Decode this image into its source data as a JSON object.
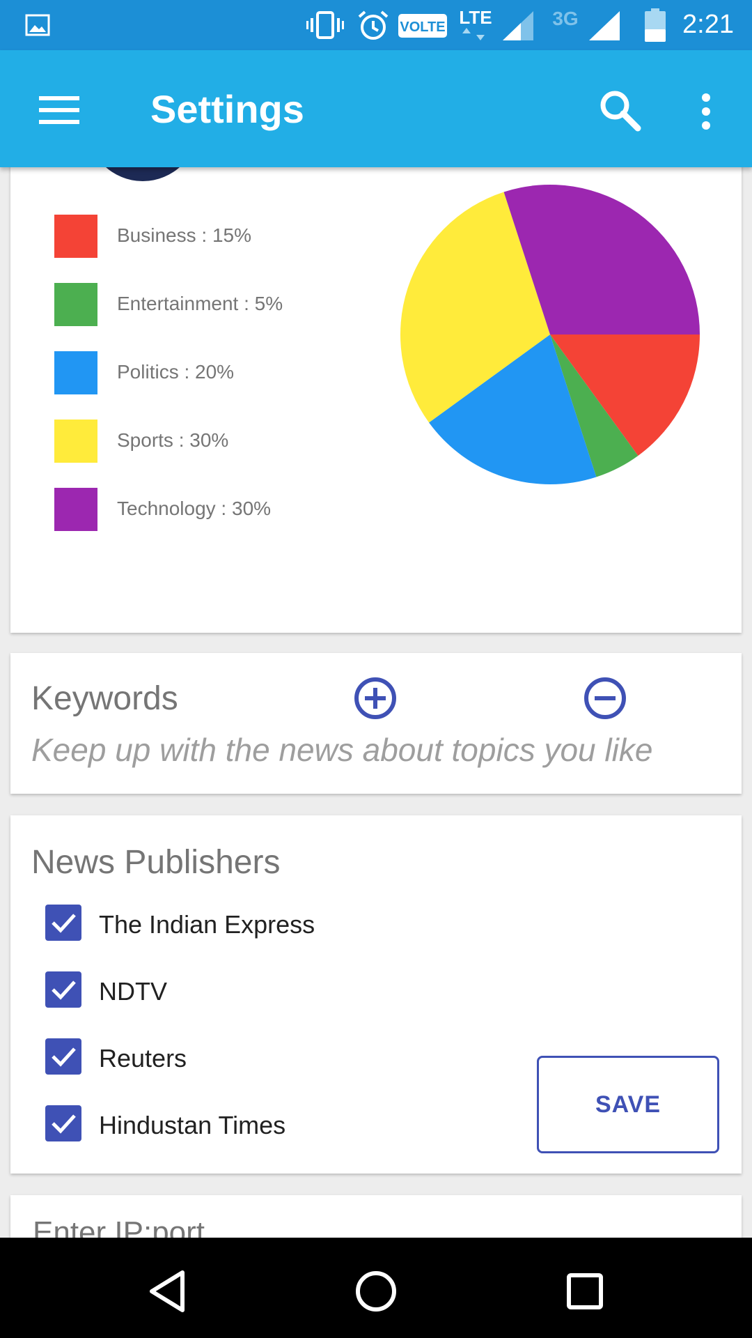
{
  "status_bar": {
    "time": "2:21",
    "volte_label": "VOLTE",
    "lte_label": "LTE",
    "network_label": "3G",
    "icons": [
      "image-icon",
      "vibrate-icon",
      "alarm-icon",
      "volte-icon",
      "lte-icon",
      "signal-icon",
      "signal-3g-icon",
      "battery-icon"
    ]
  },
  "app_bar": {
    "title": "Settings",
    "icons": [
      "menu-icon",
      "search-icon",
      "more-vert-icon"
    ]
  },
  "chart_data": {
    "type": "pie",
    "labels": [
      "Business",
      "Entertainment",
      "Politics",
      "Sports",
      "Technology"
    ],
    "values": [
      15,
      5,
      20,
      30,
      30
    ],
    "colors": [
      "#f44336",
      "#4caf50",
      "#2196f3",
      "#ffeb3b",
      "#9c27b0"
    ],
    "legend_text": [
      "Business : 15%",
      "Entertainment : 5%",
      "Politics : 20%",
      "Sports : 30%",
      "Technology : 30%"
    ],
    "legend_placement": "left"
  },
  "keywords": {
    "title": "Keywords",
    "subtitle": "Keep up with the news about topics you like",
    "icons": [
      "add-circle-icon",
      "remove-circle-icon"
    ]
  },
  "publishers": {
    "title": "News Publishers",
    "items": [
      {
        "label": "The Indian Express",
        "checked": true
      },
      {
        "label": "NDTV",
        "checked": true
      },
      {
        "label": "Reuters",
        "checked": true
      },
      {
        "label": "Hindustan Times",
        "checked": true
      }
    ],
    "save_label": "SAVE"
  },
  "ip": {
    "placeholder": "Enter IP:port"
  },
  "nav_bar": {
    "icons": [
      "back-icon",
      "home-icon",
      "recents-icon"
    ]
  },
  "colors": {
    "status_bar": "#1c8fd6",
    "app_bar": "#22aee6",
    "accent": "#3f51b5"
  }
}
